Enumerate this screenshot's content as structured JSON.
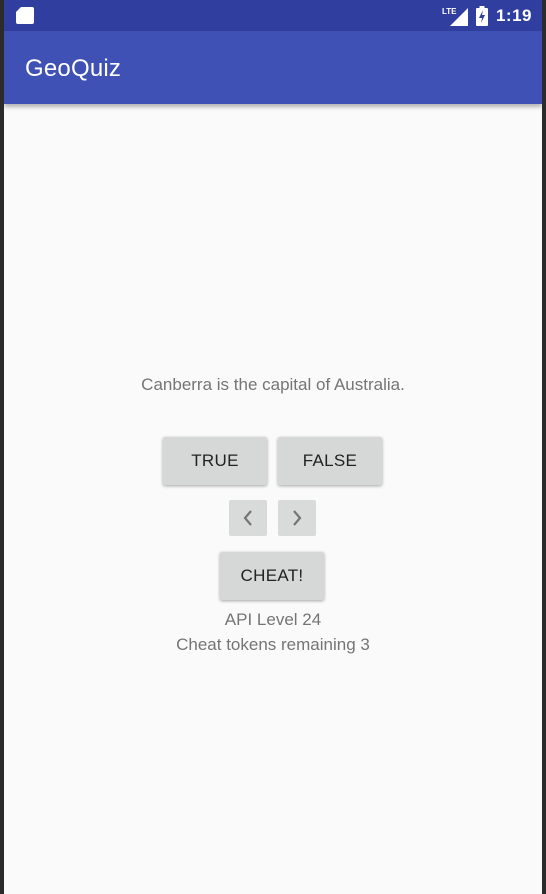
{
  "status_bar": {
    "network_label": "LTE",
    "time": "1:19",
    "icons": [
      "sd-card-icon",
      "lte-signal-icon",
      "battery-charging-icon"
    ]
  },
  "app_bar": {
    "title": "GeoQuiz"
  },
  "quiz": {
    "question": "Canberra is the capital of Australia.",
    "true_label": "TRUE",
    "false_label": "FALSE",
    "prev_icon": "chevron-left-icon",
    "next_icon": "chevron-right-icon",
    "cheat_label": "CHEAT!",
    "api_level": "API Level 24",
    "cheat_tokens": "Cheat tokens remaining 3"
  },
  "colors": {
    "status_bar": "#303f9f",
    "app_bar": "#3f51b5",
    "background": "#fafafa",
    "button": "#d6d7d7",
    "secondary_text": "#757575"
  }
}
